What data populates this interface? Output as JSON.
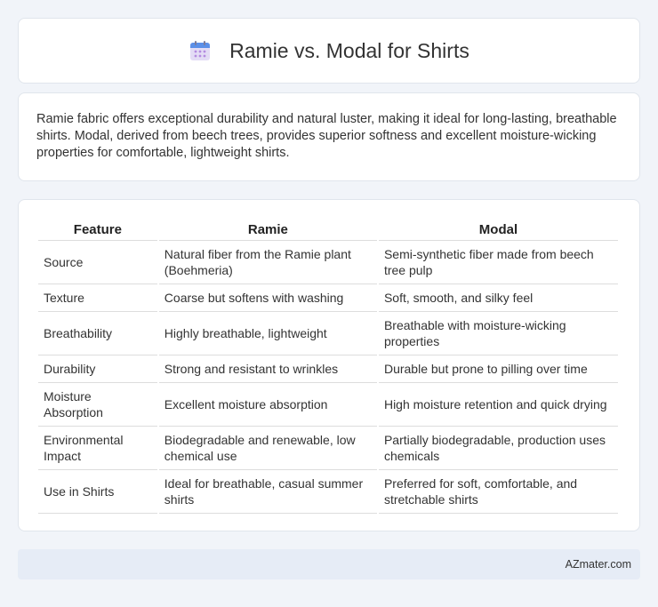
{
  "header": {
    "title": "Ramie vs. Modal for Shirts",
    "icon": "calendar-icon"
  },
  "intro": {
    "text": "Ramie fabric offers exceptional durability and natural luster, making it ideal for long-lasting, breathable shirts. Modal, derived from beech trees, provides superior softness and excellent moisture-wicking properties for comfortable, lightweight shirts."
  },
  "table": {
    "headers": [
      "Feature",
      "Ramie",
      "Modal"
    ],
    "rows": [
      [
        "Source",
        "Natural fiber from the Ramie plant (Boehmeria)",
        "Semi-synthetic fiber made from beech tree pulp"
      ],
      [
        "Texture",
        "Coarse but softens with washing",
        "Soft, smooth, and silky feel"
      ],
      [
        "Breathability",
        "Highly breathable, lightweight",
        "Breathable with moisture-wicking properties"
      ],
      [
        "Durability",
        "Strong and resistant to wrinkles",
        "Durable but prone to pilling over time"
      ],
      [
        "Moisture Absorption",
        "Excellent moisture absorption",
        "High moisture retention and quick drying"
      ],
      [
        "Environmental Impact",
        "Biodegradable and renewable, low chemical use",
        "Partially biodegradable, production uses chemicals"
      ],
      [
        "Use in Shirts",
        "Ideal for breathable, casual summer shirts",
        "Preferred for soft, comfortable, and stretchable shirts"
      ]
    ]
  },
  "footer": {
    "brand": "AZmater.com"
  }
}
